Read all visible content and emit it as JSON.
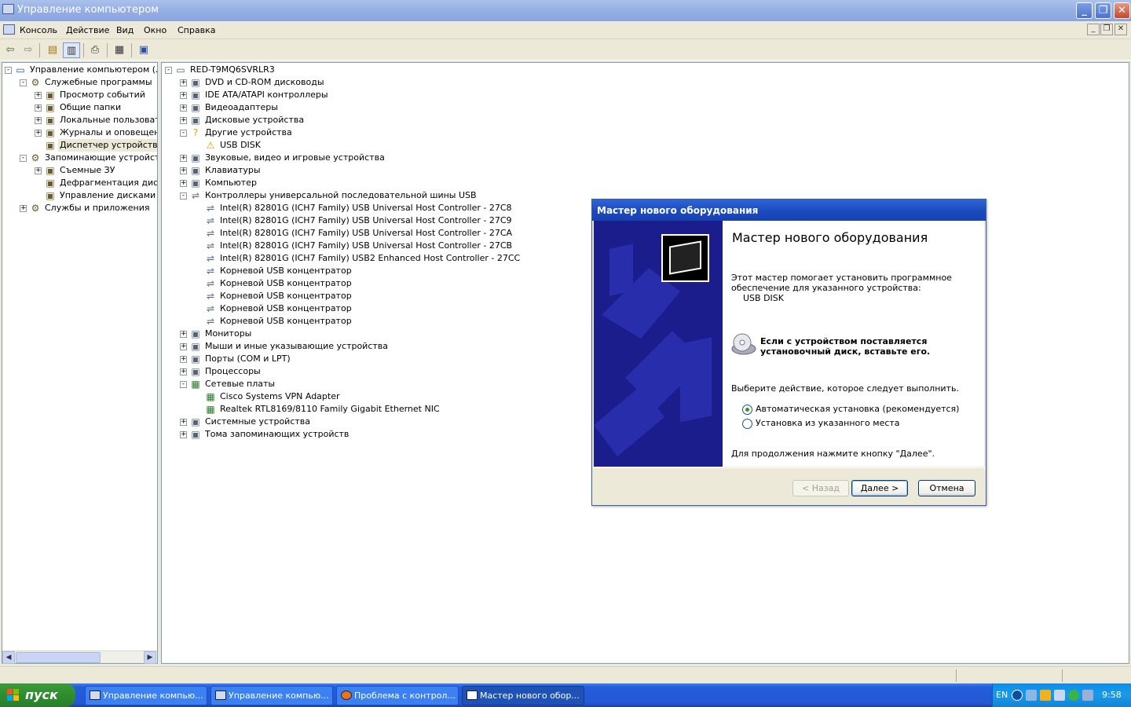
{
  "window": {
    "title": "Управление компьютером"
  },
  "menu": [
    "Консоль",
    "Действие",
    "Вид",
    "Окно",
    "Справка"
  ],
  "icons": {
    "back": "arrow-left-icon",
    "forward": "arrow-right-icon",
    "up": "folder-up-icon",
    "tree": "show-hide-tree-icon",
    "print": "printer-icon",
    "props": "properties-icon",
    "help": "help-icon"
  },
  "left_tree": [
    {
      "label": "Управление компьютером (локаль",
      "depth": 0,
      "exp": "-"
    },
    {
      "label": "Служебные программы",
      "depth": 1,
      "exp": "-"
    },
    {
      "label": "Просмотр событий",
      "depth": 2,
      "exp": "+"
    },
    {
      "label": "Общие папки",
      "depth": 2,
      "exp": "+"
    },
    {
      "label": "Локальные пользователи и",
      "depth": 2,
      "exp": "+"
    },
    {
      "label": "Журналы и оповещения пр",
      "depth": 2,
      "exp": "+"
    },
    {
      "label": "Диспетчер устройств",
      "depth": 2,
      "exp": "",
      "selected": true
    },
    {
      "label": "Запоминающие устройства",
      "depth": 1,
      "exp": "-"
    },
    {
      "label": "Съемные ЗУ",
      "depth": 2,
      "exp": "+"
    },
    {
      "label": "Дефрагментация диска",
      "depth": 2,
      "exp": ""
    },
    {
      "label": "Управление дисками",
      "depth": 2,
      "exp": ""
    },
    {
      "label": "Службы и приложения",
      "depth": 1,
      "exp": "+"
    }
  ],
  "device_tree": [
    {
      "label": "RED-T9MQ6SVRLR3",
      "depth": 0,
      "exp": "-"
    },
    {
      "label": "DVD и CD-ROM дисководы",
      "depth": 1,
      "exp": "+"
    },
    {
      "label": "IDE ATA/ATAPI контроллеры",
      "depth": 1,
      "exp": "+"
    },
    {
      "label": "Видеоадаптеры",
      "depth": 1,
      "exp": "+"
    },
    {
      "label": "Дисковые устройства",
      "depth": 1,
      "exp": "+"
    },
    {
      "label": "Другие устройства",
      "depth": 1,
      "exp": "-"
    },
    {
      "label": "USB DISK",
      "depth": 2,
      "exp": ""
    },
    {
      "label": "Звуковые, видео и игровые устройства",
      "depth": 1,
      "exp": "+"
    },
    {
      "label": "Клавиатуры",
      "depth": 1,
      "exp": "+"
    },
    {
      "label": "Компьютер",
      "depth": 1,
      "exp": "+"
    },
    {
      "label": "Контроллеры универсальной последовательной шины USB",
      "depth": 1,
      "exp": "-"
    },
    {
      "label": "Intel(R) 82801G (ICH7 Family) USB Universal Host Controller - 27C8",
      "depth": 2,
      "exp": ""
    },
    {
      "label": "Intel(R) 82801G (ICH7 Family) USB Universal Host Controller - 27C9",
      "depth": 2,
      "exp": ""
    },
    {
      "label": "Intel(R) 82801G (ICH7 Family) USB Universal Host Controller - 27CA",
      "depth": 2,
      "exp": ""
    },
    {
      "label": "Intel(R) 82801G (ICH7 Family) USB Universal Host Controller - 27CB",
      "depth": 2,
      "exp": ""
    },
    {
      "label": "Intel(R) 82801G (ICH7 Family) USB2 Enhanced Host Controller - 27CC",
      "depth": 2,
      "exp": ""
    },
    {
      "label": "Корневой USB концентратор",
      "depth": 2,
      "exp": ""
    },
    {
      "label": "Корневой USB концентратор",
      "depth": 2,
      "exp": ""
    },
    {
      "label": "Корневой USB концентратор",
      "depth": 2,
      "exp": ""
    },
    {
      "label": "Корневой USB концентратор",
      "depth": 2,
      "exp": ""
    },
    {
      "label": "Корневой USB концентратор",
      "depth": 2,
      "exp": ""
    },
    {
      "label": "Мониторы",
      "depth": 1,
      "exp": "+"
    },
    {
      "label": "Мыши и иные указывающие устройства",
      "depth": 1,
      "exp": "+"
    },
    {
      "label": "Порты (COM и LPT)",
      "depth": 1,
      "exp": "+"
    },
    {
      "label": "Процессоры",
      "depth": 1,
      "exp": "+"
    },
    {
      "label": "Сетевые платы",
      "depth": 1,
      "exp": "-"
    },
    {
      "label": "Cisco Systems VPN Adapter",
      "depth": 2,
      "exp": ""
    },
    {
      "label": "Realtek RTL8169/8110 Family Gigabit Ethernet NIC",
      "depth": 2,
      "exp": ""
    },
    {
      "label": "Системные устройства",
      "depth": 1,
      "exp": "+"
    },
    {
      "label": "Тома запоминающих устройств",
      "depth": 1,
      "exp": "+"
    }
  ],
  "dialog": {
    "title": "Мастер нового оборудования",
    "heading": "Мастер нового оборудования",
    "intro_line1": "Этот мастер помогает установить программное",
    "intro_line2": "обеспечение для указанного устройства:",
    "device": "USB DISK",
    "cd_line1": "Если с устройством поставляется",
    "cd_line2": "установочный диск, вставьте его.",
    "choose": "Выберите действие, которое следует выполнить.",
    "option_auto": "Автоматическая установка (рекомендуется)",
    "option_manual": "Установка из указанного места",
    "continue": "Для продолжения нажмите кнопку \"Далее\".",
    "back_btn": "< Назад",
    "next_btn": "Далее >",
    "cancel_btn": "Отмена"
  },
  "taskbar": {
    "start": "пуск",
    "tasks": [
      {
        "label": "Управление компью..."
      },
      {
        "label": "Управление компью..."
      },
      {
        "label": "Проблема с контрол..."
      },
      {
        "label": "Мастер нового обор..."
      }
    ],
    "lang": "EN",
    "clock": "9:58"
  },
  "colors": {
    "accent": "#245edb",
    "dialog_sidebar": "#1b1d8c",
    "start": "#2f8d2f"
  }
}
